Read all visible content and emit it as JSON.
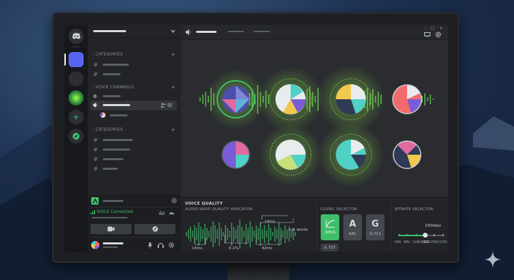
{
  "sidebar": {
    "categories": [
      {
        "label": "CATEGORIES"
      },
      {
        "label": "VOICE CHANNELS"
      },
      {
        "label": "CATEGORIES"
      }
    ]
  },
  "voice_status": {
    "label": "VOICE Connected"
  },
  "voice_quality": {
    "title": "VOICE QUALITY",
    "indicator_label": "AUDIO WAVE QUALITY INDICATOR",
    "annotations": [
      "14ms",
      "not words",
      "14ms",
      "0.1%",
      "42ms"
    ]
  },
  "codec_selector": {
    "title": "CODEC SELECTOR",
    "options": [
      {
        "letter": "",
        "label": "OPUS",
        "selected": true
      },
      {
        "letter": "A",
        "label": "AAC",
        "selected": false
      },
      {
        "letter": "G",
        "label": "G.711",
        "selected": false
      }
    ],
    "extra": "G.722"
  },
  "bitrate_selector": {
    "title": "BITRATE SELECTOR",
    "current": "192kbps",
    "options": [
      "64k",
      "96k",
      "128k",
      "192k",
      "256k",
      "320k"
    ],
    "selected_index": 3
  },
  "colors": {
    "accent_green": "#3fbf6a",
    "glow_green": "#9bff4a",
    "brand": "#5865f2"
  },
  "icons": [
    "discord-logo-icon",
    "add-server-icon",
    "explore-icon",
    "mute-icon",
    "headphones-icon",
    "gear-icon",
    "camera-icon",
    "screen-share-icon",
    "speaker-icon"
  ]
}
